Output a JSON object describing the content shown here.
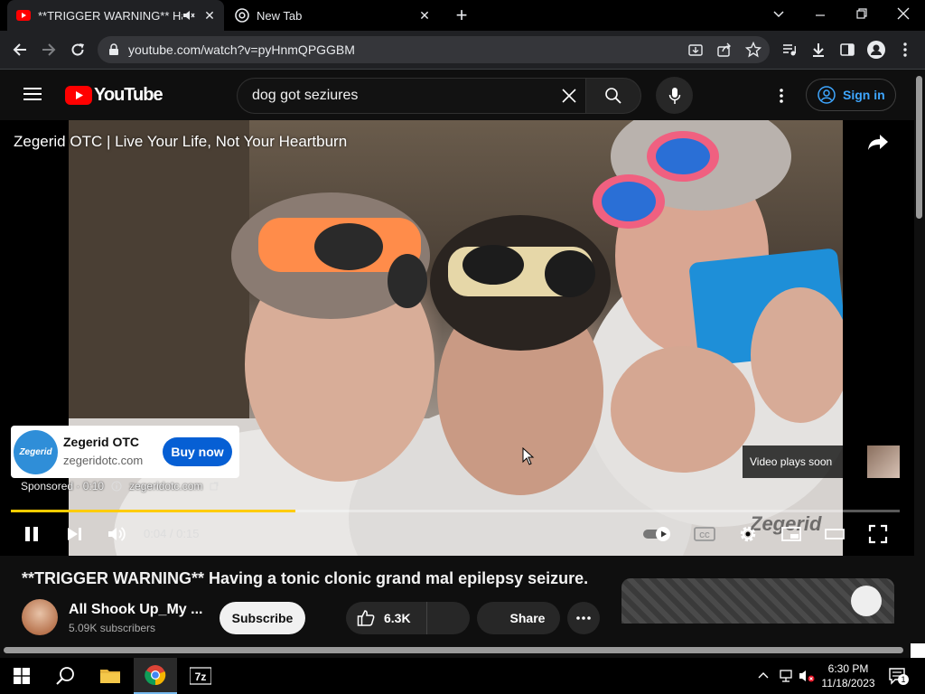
{
  "browser": {
    "tabs": [
      {
        "title": "**TRIGGER WARNING** Hav"
      },
      {
        "title": "New Tab"
      }
    ],
    "url": "youtube.com/watch?v=pyHnmQPGGBM"
  },
  "youtube": {
    "logo_text": "YouTube",
    "search_query": "dog got seziures",
    "sign_in": "Sign in"
  },
  "player": {
    "ad_title": "Zegerid OTC | Live Your Life, Not Your Heartburn",
    "ad_card": {
      "logo_text": "Zegerid",
      "name": "Zegerid OTC",
      "url": "zegeridotc.com",
      "button": "Buy now"
    },
    "sponsored_label": "Sponsored · 0:10",
    "sponsored_link": "zegeridotc.com",
    "video_plays_soon": "Video plays soon",
    "time": "0:04 / 0:15",
    "progress": 0.32,
    "watermark": "Zegerid",
    "accent_color": "#ffcc00"
  },
  "video": {
    "title": "**TRIGGER WARNING** Having a tonic clonic grand mal epilepsy seizure.",
    "channel": "All Shook Up_My ...",
    "subscribers": "5.09K subscribers",
    "subscribe": "Subscribe",
    "likes": "6.3K",
    "share": "Share"
  },
  "taskbar": {
    "time": "6:30 PM",
    "date": "11/18/2023",
    "notification_count": "1"
  }
}
